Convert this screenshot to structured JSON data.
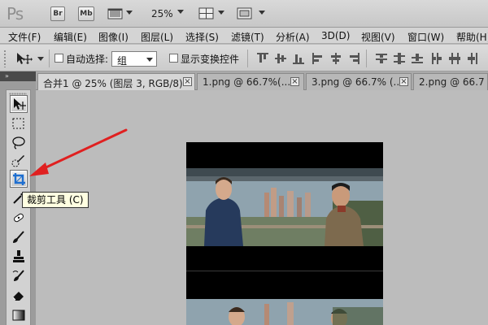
{
  "app": {
    "logo": "Ps",
    "bridge_label": "Br",
    "minibridge_label": "Mb",
    "zoom": "25%"
  },
  "menu": [
    "文件(F)",
    "编辑(E)",
    "图像(I)",
    "图层(L)",
    "选择(S)",
    "滤镜(T)",
    "分析(A)",
    "3D(D)",
    "视图(V)",
    "窗口(W)",
    "帮助(H)"
  ],
  "options": {
    "auto_select_label": "自动选择:",
    "auto_select_value": "组",
    "show_transform_label": "显示变换控件"
  },
  "tabs": [
    {
      "title": "合并1 @ 25% (图层 3, RGB/8) *",
      "active": true
    },
    {
      "title": "1.png @ 66.7%(...",
      "active": false
    },
    {
      "title": "3.png @ 66.7% (...",
      "active": false
    },
    {
      "title": "2.png @ 66.7",
      "active": false
    }
  ],
  "tooltip": "裁剪工具 (C)",
  "tools": [
    "move-tool-icon",
    "marquee-tool-icon",
    "lasso-tool-icon",
    "quick-selection-tool-icon",
    "crop-tool-icon",
    "eyedropper-tool-icon",
    "healing-brush-tool-icon",
    "brush-tool-icon",
    "clone-stamp-tool-icon",
    "history-brush-tool-icon",
    "eraser-tool-icon",
    "gradient-tool-icon"
  ],
  "colors": {
    "accent_arrow": "#e02020",
    "crop_icon": "#1f6fd0",
    "tooltip_bg": "#ffffe1"
  }
}
